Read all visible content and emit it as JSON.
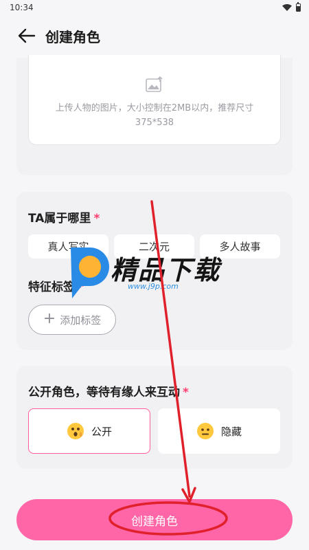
{
  "status_bar": {
    "time": "10:34"
  },
  "header": {
    "title": "创建角色",
    "back_icon": "arrow-left-icon"
  },
  "upload": {
    "icon": "image-upload-icon",
    "hint": "上传人物的图片，大小控制在2MB以内，推荐尺寸375*538"
  },
  "belong_section": {
    "title": "TA属于哪里",
    "required_mark": "*",
    "options": [
      {
        "label": "真人写实"
      },
      {
        "label": "二次元"
      },
      {
        "label": "多人故事"
      }
    ]
  },
  "tags_section": {
    "title": "特征标签",
    "required_mark": "*",
    "add_label": "添加标签",
    "add_icon": "plus-icon"
  },
  "public_section": {
    "title": "公开角色，等待有缘人来互动",
    "required_mark": "*",
    "options": [
      {
        "label": "公开",
        "icon": "surprised-face-icon",
        "selected": true
      },
      {
        "label": "隐藏",
        "icon": "neutral-face-icon",
        "selected": false
      }
    ]
  },
  "create_button": {
    "label": "创建角色"
  },
  "watermark": {
    "text": "精品下载",
    "url": "www.j9p.com"
  },
  "colors": {
    "accent": "#ff66a8",
    "selected_border": "#ff5c9f",
    "required": "#ff3d6e",
    "annotation_red": "#e0202a"
  }
}
